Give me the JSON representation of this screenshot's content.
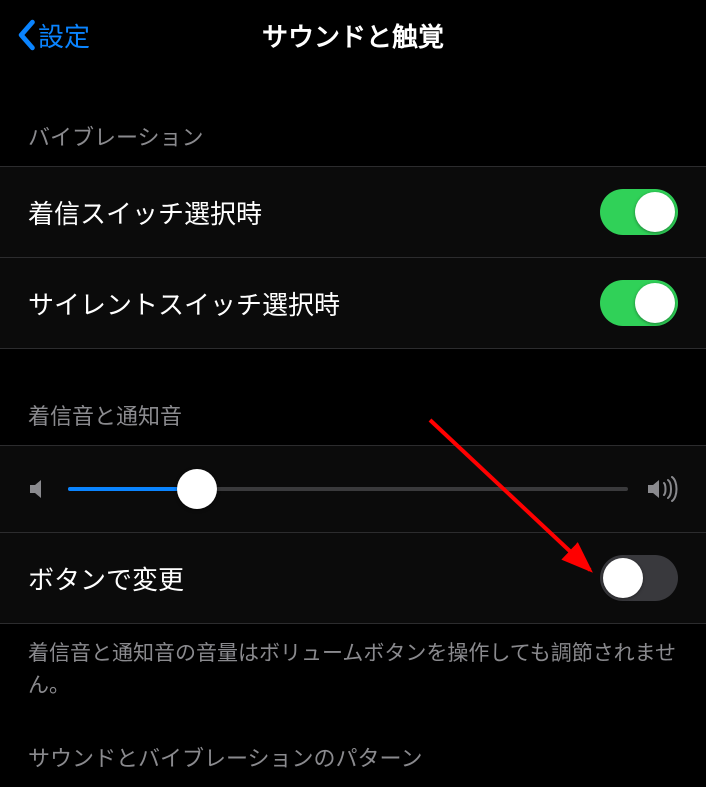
{
  "nav": {
    "back_label": "設定",
    "title": "サウンドと触覚"
  },
  "sections": {
    "vibration": {
      "header": "バイブレーション",
      "ring_switch": {
        "label": "着信スイッチ選択時",
        "on": true
      },
      "silent_switch": {
        "label": "サイレントスイッチ選択時",
        "on": true
      }
    },
    "ringer": {
      "header": "着信音と通知音",
      "volume_percent": 23,
      "change_with_buttons": {
        "label": "ボタンで変更",
        "on": false
      },
      "footer": "着信音と通知音の音量はボリュームボタンを操作しても調節されません。"
    },
    "patterns": {
      "header": "サウンドとバイブレーションのパターン"
    }
  },
  "annotation": {
    "arrow_target": "change-with-buttons-toggle"
  }
}
